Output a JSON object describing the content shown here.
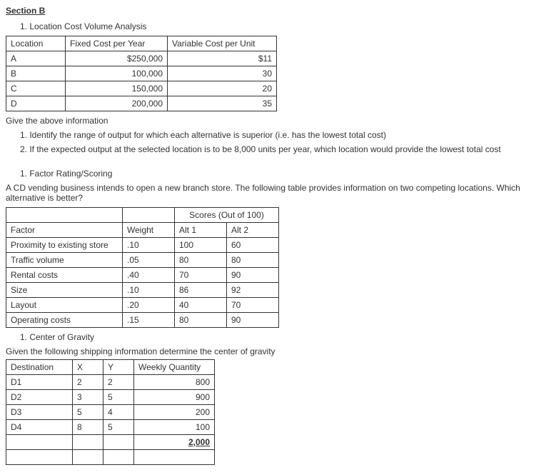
{
  "section_b": {
    "title": "Section B",
    "q1": {
      "heading": "1. Location Cost Volume Analysis",
      "headers": [
        "Location",
        "Fixed Cost per Year",
        "Variable Cost per Unit"
      ],
      "rows": [
        {
          "loc": "A",
          "fixed": "$250,000",
          "var": "$11"
        },
        {
          "loc": "B",
          "fixed": "100,000",
          "var": "30"
        },
        {
          "loc": "C",
          "fixed": "150,000",
          "var": "20"
        },
        {
          "loc": "D",
          "fixed": "200,000",
          "var": "35"
        }
      ],
      "note": "Give the above information",
      "sub1": "1. Identify the range of output for which each alternative is superior (i.e. has the lowest total cost)",
      "sub2": "2. If the expected output at the selected location is to be 8,000 units per year, which location would provide the lowest total cost"
    },
    "q2": {
      "heading": "1. Factor Rating/Scoring",
      "intro": "A CD vending business intends to open a new branch store. The following table provides information on two competing locations. Which alternative is better?",
      "scores_header": "Scores (Out of 100)",
      "col_factor": "Factor",
      "col_weight": "Weight",
      "col_alt1": "Alt 1",
      "col_alt2": "Alt 2",
      "rows": [
        {
          "f": "Proximity to existing store",
          "w": ".10",
          "a1": "100",
          "a2": "60"
        },
        {
          "f": "Traffic volume",
          "w": ".05",
          "a1": "80",
          "a2": "80"
        },
        {
          "f": "Rental costs",
          "w": ".40",
          "a1": "70",
          "a2": "90"
        },
        {
          "f": "Size",
          "w": ".10",
          "a1": "86",
          "a2": "92"
        },
        {
          "f": "Layout",
          "w": ".20",
          "a1": "40",
          "a2": "70"
        },
        {
          "f": "Operating costs",
          "w": ".15",
          "a1": "80",
          "a2": "90"
        }
      ]
    },
    "q3": {
      "heading": "1. Center of Gravity",
      "intro": "Given the following shipping information determine the center of gravity",
      "headers": [
        "Destination",
        "X",
        "Y",
        "Weekly Quantity"
      ],
      "rows": [
        {
          "d": "D1",
          "x": "2",
          "y": "2",
          "q": "800"
        },
        {
          "d": "D2",
          "x": "3",
          "y": "5",
          "q": "900"
        },
        {
          "d": "D3",
          "x": "5",
          "y": "4",
          "q": "200"
        },
        {
          "d": "D4",
          "x": "8",
          "y": "5",
          "q": "100"
        }
      ],
      "total": "2,000"
    }
  }
}
